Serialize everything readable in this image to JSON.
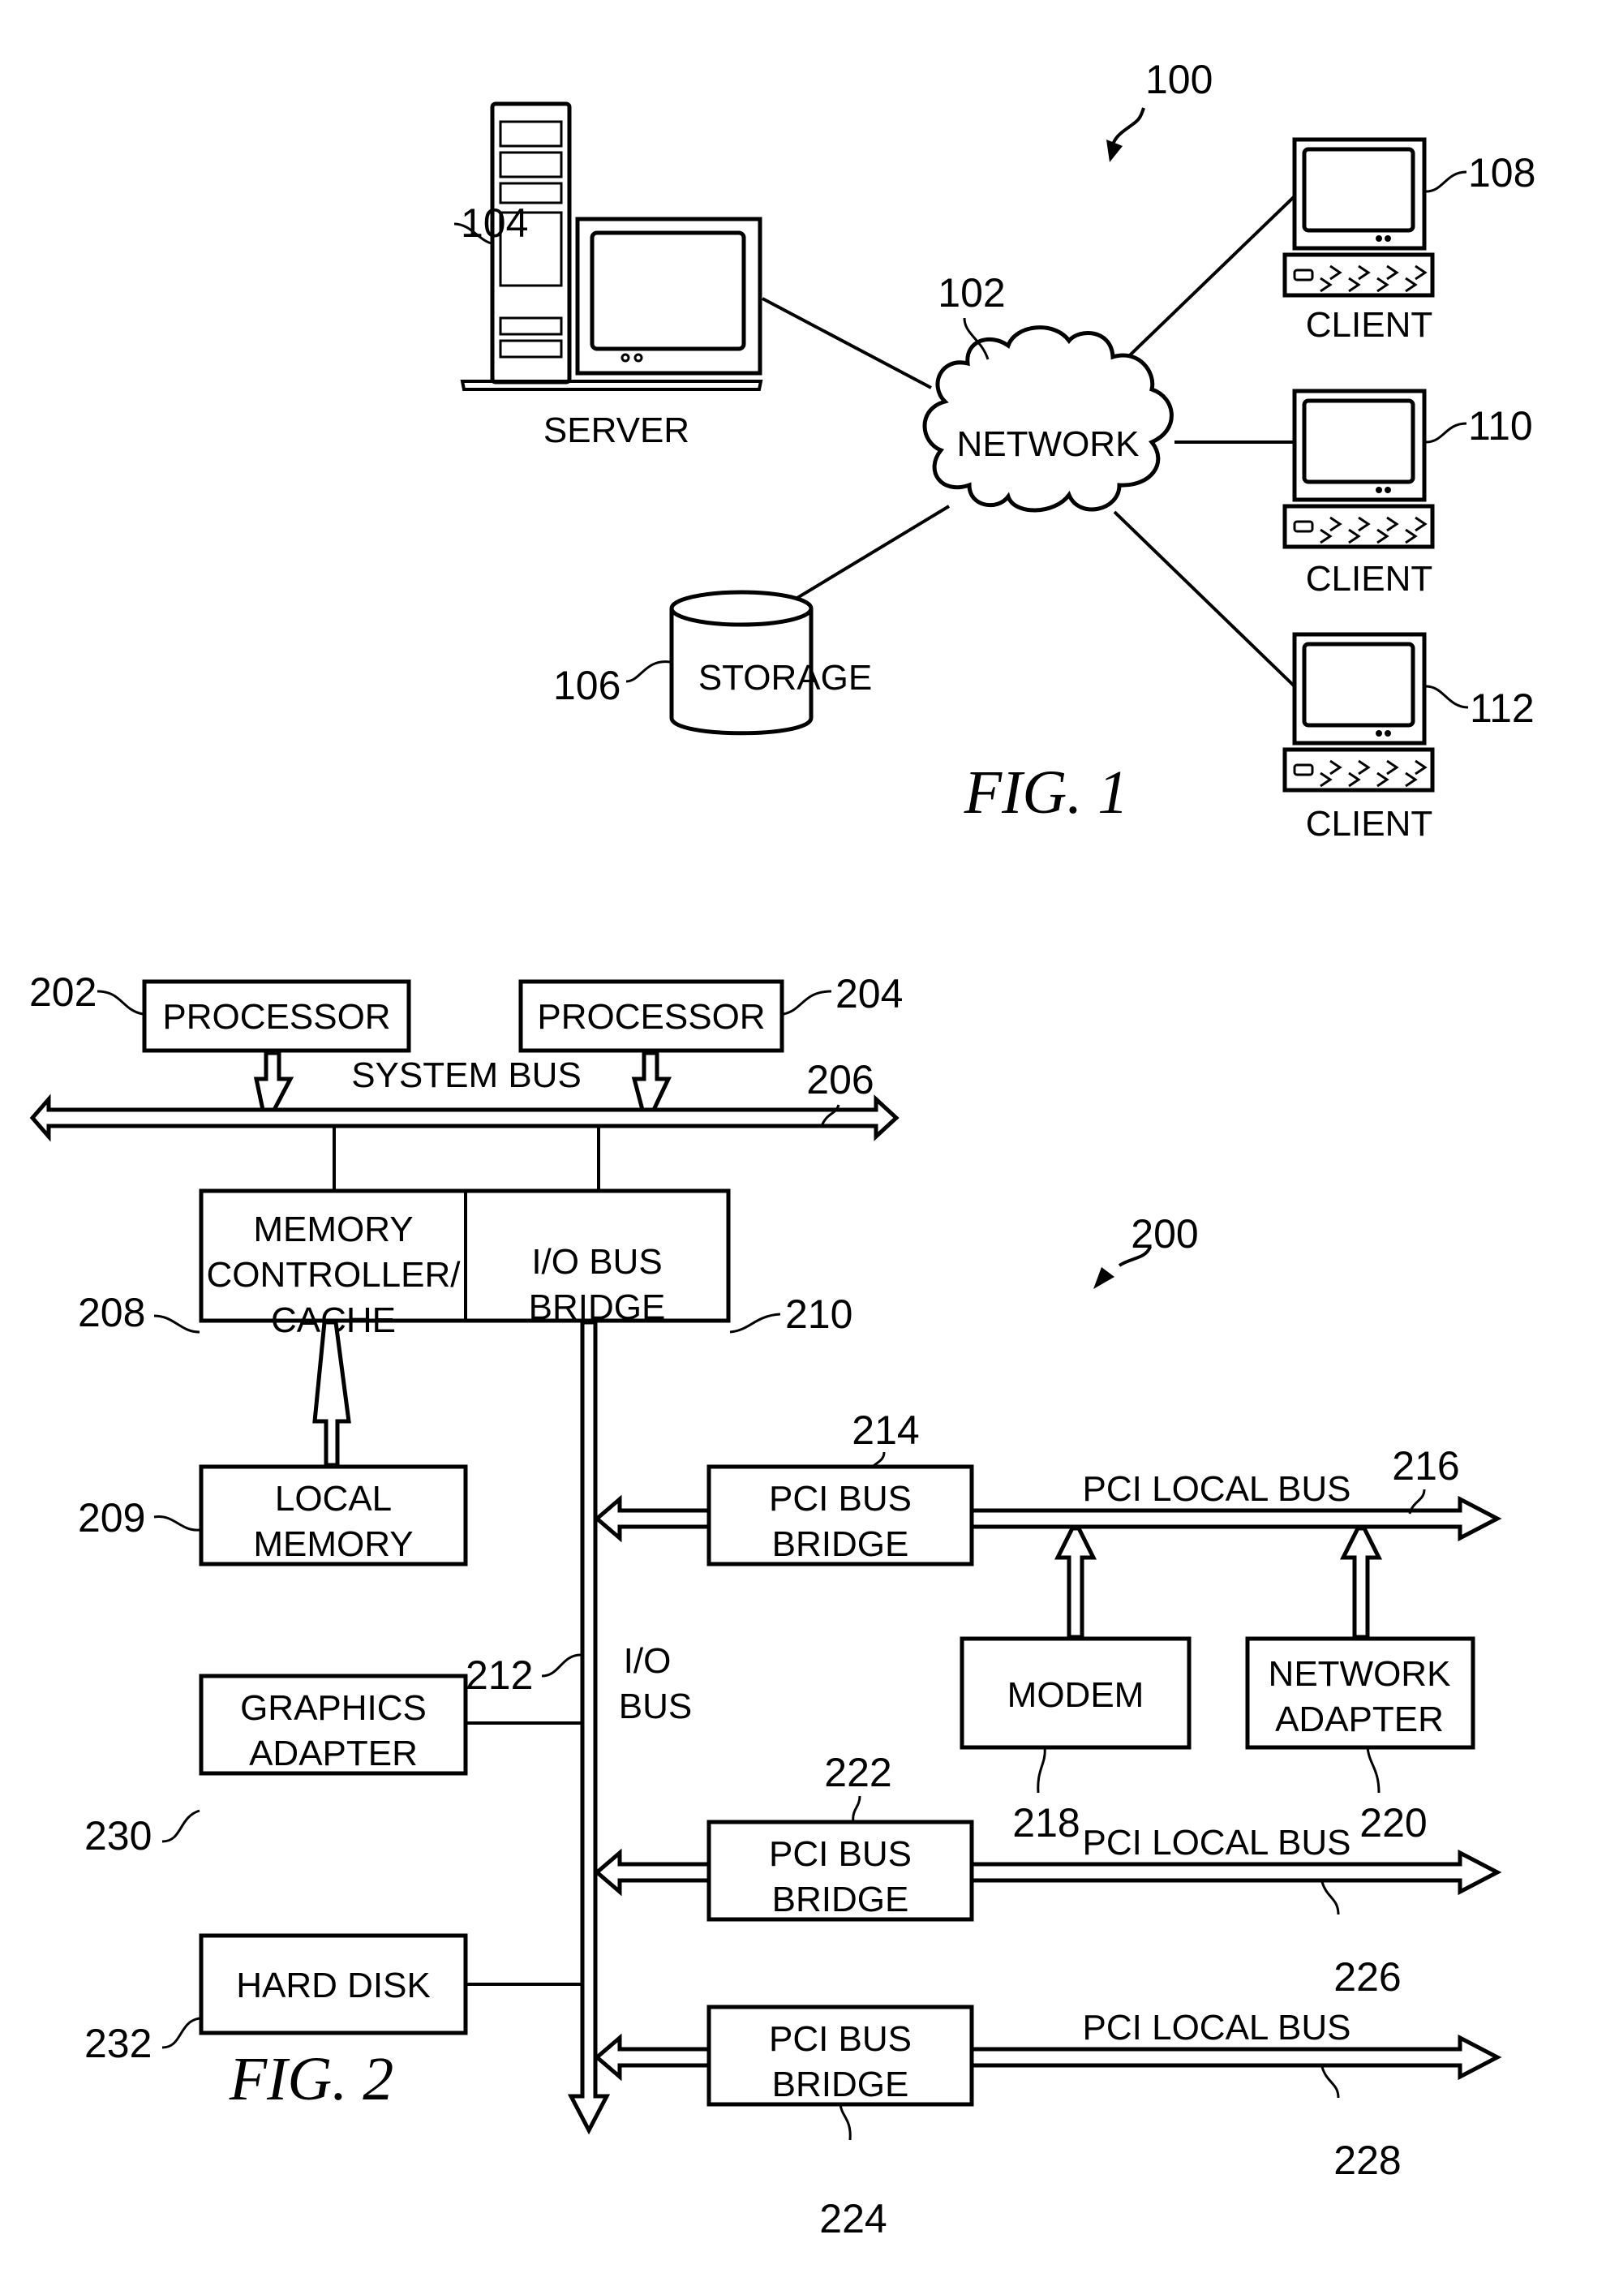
{
  "figure1": {
    "caption": "FIG. 1",
    "ref": "100",
    "server": {
      "ref": "104",
      "label": "SERVER"
    },
    "network": {
      "ref": "102",
      "label": "NETWORK"
    },
    "storage": {
      "ref": "106",
      "label": "STORAGE"
    },
    "clients": [
      {
        "ref": "108",
        "label": "CLIENT"
      },
      {
        "ref": "110",
        "label": "CLIENT"
      },
      {
        "ref": "112",
        "label": "CLIENT"
      }
    ]
  },
  "figure2": {
    "caption": "FIG. 2",
    "ref": "200",
    "processor_a": {
      "ref": "202",
      "label": "PROCESSOR"
    },
    "processor_b": {
      "ref": "204",
      "label": "PROCESSOR"
    },
    "system_bus": {
      "ref": "206",
      "label": "SYSTEM BUS"
    },
    "memory_controller": {
      "ref": "208",
      "lines": [
        "MEMORY",
        "CONTROLLER/",
        "CACHE"
      ]
    },
    "local_memory": {
      "ref": "209",
      "lines": [
        "LOCAL",
        "MEMORY"
      ]
    },
    "io_bridge": {
      "ref": "210",
      "lines": [
        "I/O BUS",
        "BRIDGE"
      ]
    },
    "io_bus": {
      "ref": "212",
      "lines": [
        "I/O",
        "BUS"
      ]
    },
    "pci_bridge_1": {
      "ref": "214",
      "lines": [
        "PCI BUS",
        "BRIDGE"
      ]
    },
    "pci_local_bus_1": {
      "ref": "216",
      "label": "PCI LOCAL BUS"
    },
    "modem": {
      "ref": "218",
      "label": "MODEM"
    },
    "network_adapter": {
      "ref": "220",
      "lines": [
        "NETWORK",
        "ADAPTER"
      ]
    },
    "pci_bridge_2": {
      "ref": "222",
      "lines": [
        "PCI BUS",
        "BRIDGE"
      ]
    },
    "pci_bridge_3": {
      "ref": "224",
      "lines": [
        "PCI BUS",
        "BRIDGE"
      ]
    },
    "pci_local_bus_2": {
      "ref": "226",
      "label": "PCI LOCAL BUS"
    },
    "pci_local_bus_3": {
      "ref": "228",
      "label": "PCI LOCAL BUS"
    },
    "graphics_adapter": {
      "ref": "230",
      "lines": [
        "GRAPHICS",
        "ADAPTER"
      ]
    },
    "hard_disk": {
      "ref": "232",
      "label": "HARD DISK"
    }
  }
}
